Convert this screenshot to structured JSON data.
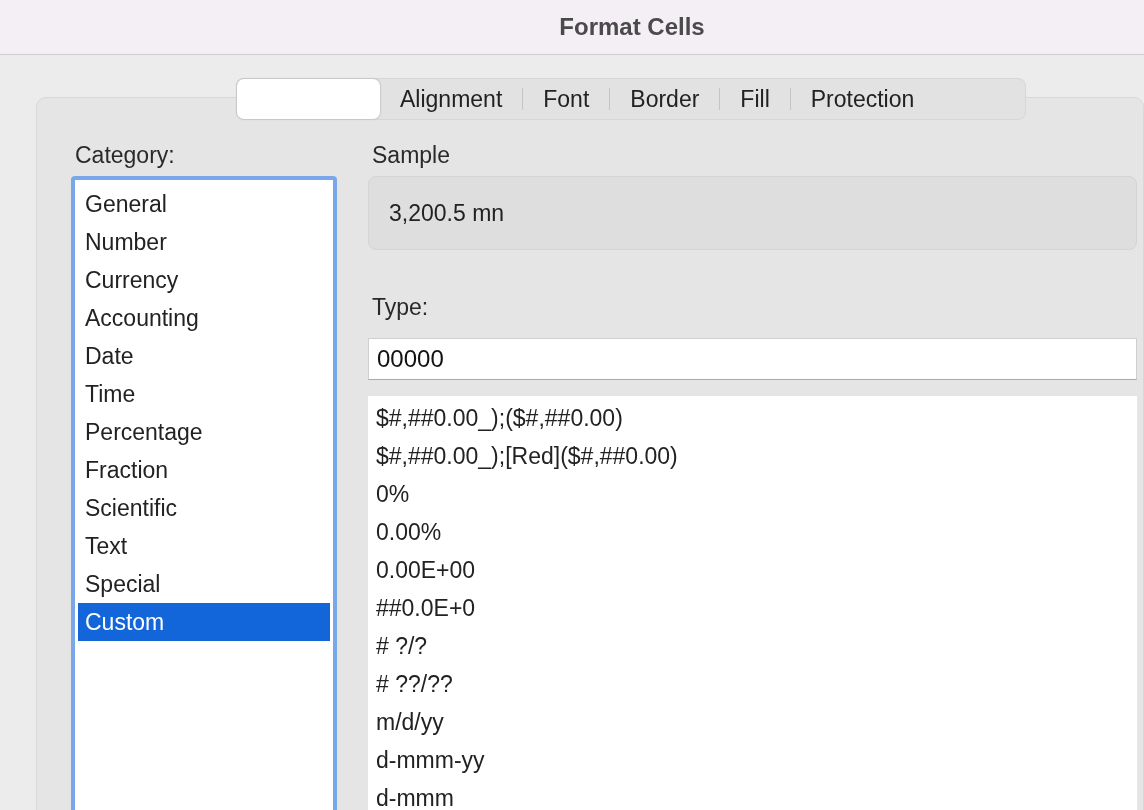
{
  "window": {
    "title": "Format Cells"
  },
  "tabs": [
    {
      "selected": true
    },
    {
      "label": "Alignment",
      "selected": false
    },
    {
      "label": "Font",
      "selected": false
    },
    {
      "label": "Border",
      "selected": false
    },
    {
      "label": "Fill",
      "selected": false
    },
    {
      "label": "Protection",
      "selected": false
    }
  ],
  "category": {
    "label": "Category:",
    "items": [
      {
        "label": "General",
        "selected": false
      },
      {
        "label": "Number",
        "selected": false
      },
      {
        "label": "Currency",
        "selected": false
      },
      {
        "label": "Accounting",
        "selected": false
      },
      {
        "label": "Date",
        "selected": false
      },
      {
        "label": "Time",
        "selected": false
      },
      {
        "label": "Percentage",
        "selected": false
      },
      {
        "label": "Fraction",
        "selected": false
      },
      {
        "label": "Scientific",
        "selected": false
      },
      {
        "label": "Text",
        "selected": false
      },
      {
        "label": "Special",
        "selected": false
      },
      {
        "label": "Custom",
        "selected": true
      }
    ]
  },
  "sample": {
    "label": "Sample",
    "value": "3,200.5 mn"
  },
  "type": {
    "label": "Type:",
    "value": "00000",
    "options": [
      "$#,##0.00_);($#,##0.00)",
      "$#,##0.00_);[Red]($#,##0.00)",
      "0%",
      "0.00%",
      "0.00E+00",
      "##0.0E+0",
      "# ?/?",
      "# ??/??",
      "m/d/yy",
      "d-mmm-yy",
      "d-mmm"
    ]
  }
}
